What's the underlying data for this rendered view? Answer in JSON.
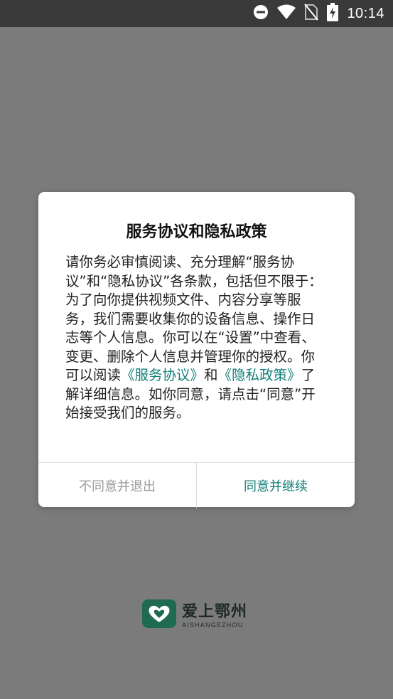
{
  "status_bar": {
    "time": "10:14",
    "icons": [
      "do-not-disturb-icon",
      "wifi-icon",
      "no-sim-icon",
      "battery-charging-icon"
    ]
  },
  "dialog": {
    "title": "服务协议和隐私政策",
    "body": {
      "part1": "请你务必审慎阅读、充分理解“服务协议”和“隐私协议”各条款，包括但不限于：为了向你提供视频文件、内容分享等服务，我们需要收集你的设备信息、操作日志等个人信息。你可以在“设置”中查看、变更、删除个人信息并管理你的授权。你可以阅读",
      "link_service": "《服务协议》",
      "part2": "和",
      "link_privacy": "《隐私政策》",
      "part3": "了解详细信息。如你同意，请点击“同意”开始接受我们的服务。"
    },
    "buttons": {
      "disagree": "不同意并退出",
      "agree": "同意并继续"
    }
  },
  "brand": {
    "name": "爱上鄂州",
    "subtitle": "AISHANGEZHOU"
  },
  "colors": {
    "accent": "#13807a",
    "overlay": "#7b7b7b",
    "brand_green": "#1e6b51"
  }
}
